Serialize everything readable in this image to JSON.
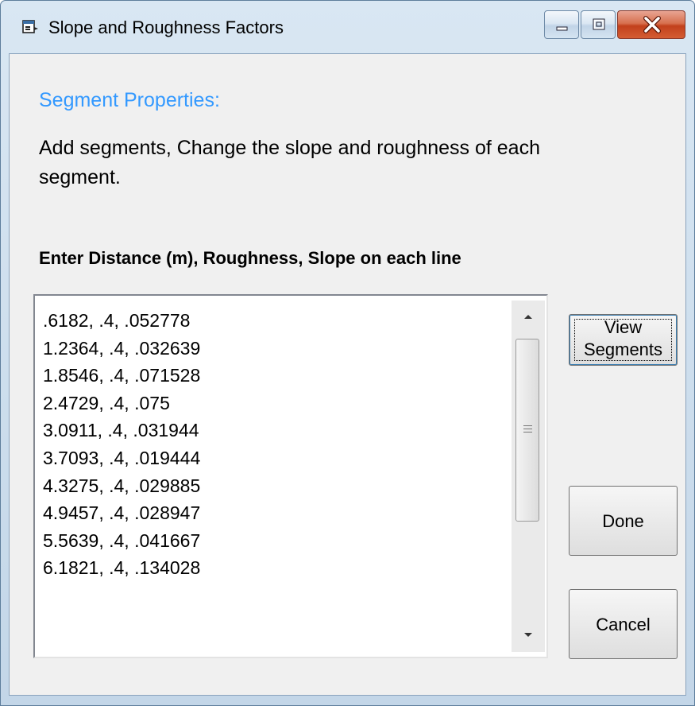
{
  "window": {
    "title": "Slope and Roughness Factors",
    "controls": [
      "minimize",
      "maximize",
      "close"
    ]
  },
  "content": {
    "heading": "Segment Properties:",
    "description": "Add segments, Change the slope and roughness of each segment.",
    "instruction": "Enter Distance (m), Roughness, Slope on each line"
  },
  "segments": {
    "lines": [
      ".6182,  .4,  .052778",
      "1.2364,  .4,  .032639",
      "1.8546,  .4,  .071528",
      "2.4729,  .4,  .075",
      "3.0911,  .4,  .031944",
      "3.7093,  .4,  .019444",
      "4.3275,  .4,  .029885",
      "4.9457,  .4,  .028947",
      "5.5639,  .4,  .041667",
      "6.1821,  .4,  .134028"
    ]
  },
  "buttons": {
    "view_segments_line1": "View",
    "view_segments_line2": "Segments",
    "done": "Done",
    "cancel": "Cancel"
  },
  "colors": {
    "heading": "#3399ff",
    "close_button": "#c2401c",
    "dialog_background": "#f0f0f0"
  },
  "icons": {
    "app": "window-app-icon",
    "minimize": "minimize-icon",
    "maximize": "maximize-icon",
    "close": "close-icon"
  }
}
